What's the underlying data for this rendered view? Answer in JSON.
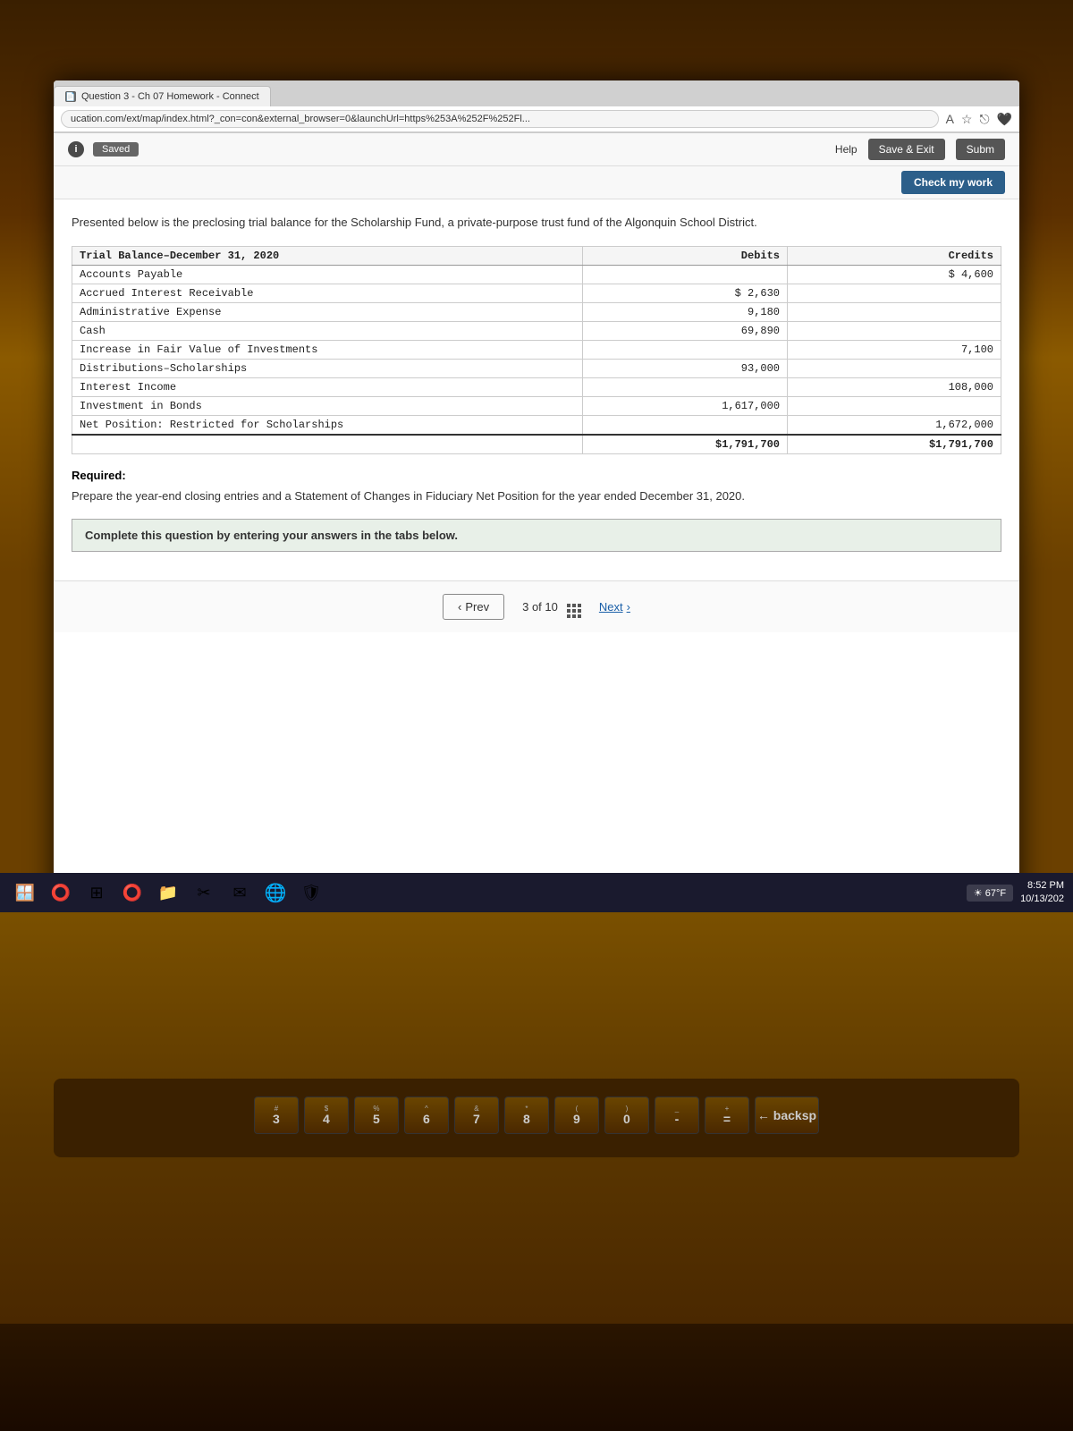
{
  "browser": {
    "tab_label": "Question 3 - Ch 07 Homework - Connect",
    "tab_icon": "📄",
    "address_url": "ucation.com/ext/map/index.html?_con=con&external_browser=0&launchUrl=https%253A%252F%252Fl...",
    "saved_label": "Saved"
  },
  "topbar": {
    "info_icon": "i",
    "help_label": "Help",
    "save_exit_label": "Save & Exit",
    "submit_label": "Subm",
    "check_my_work_label": "Check my work"
  },
  "intro_text": "Presented below is the preclosing trial balance for the Scholarship Fund, a private-purpose trust fund of the Algonquin School District.",
  "trial_balance": {
    "title": "Trial Balance–December 31, 2020",
    "col_debits": "Debits",
    "col_credits": "Credits",
    "rows": [
      {
        "account": "Accounts Payable",
        "debit": "",
        "credit": "$ 4,600"
      },
      {
        "account": "Accrued Interest Receivable",
        "debit": "$ 2,630",
        "credit": ""
      },
      {
        "account": "Administrative Expense",
        "debit": "9,180",
        "credit": ""
      },
      {
        "account": "Cash",
        "debit": "69,890",
        "credit": ""
      },
      {
        "account": "Increase in Fair Value of Investments",
        "debit": "",
        "credit": "7,100"
      },
      {
        "account": "Distributions–Scholarships",
        "debit": "93,000",
        "credit": ""
      },
      {
        "account": "Interest Income",
        "debit": "",
        "credit": "108,000"
      },
      {
        "account": "Investment in Bonds",
        "debit": "1,617,000",
        "credit": ""
      },
      {
        "account": "Net Position: Restricted for Scholarships",
        "debit": "",
        "credit": "1,672,000"
      }
    ],
    "total_row": {
      "debit": "$1,791,700",
      "credit": "$1,791,700"
    }
  },
  "required": {
    "title": "Required:",
    "text": "Prepare the year-end closing entries and a Statement of Changes in Fiduciary Net Position for the year ended December 31, 2020."
  },
  "instructions": {
    "text": "Complete this question by entering your answers in the tabs below."
  },
  "navigation": {
    "prev_label": "Prev",
    "page_info": "3 of 10",
    "next_label": "Next"
  },
  "taskbar": {
    "weather": "67°F",
    "time": "8:52 PM",
    "date": "10/13/202"
  }
}
